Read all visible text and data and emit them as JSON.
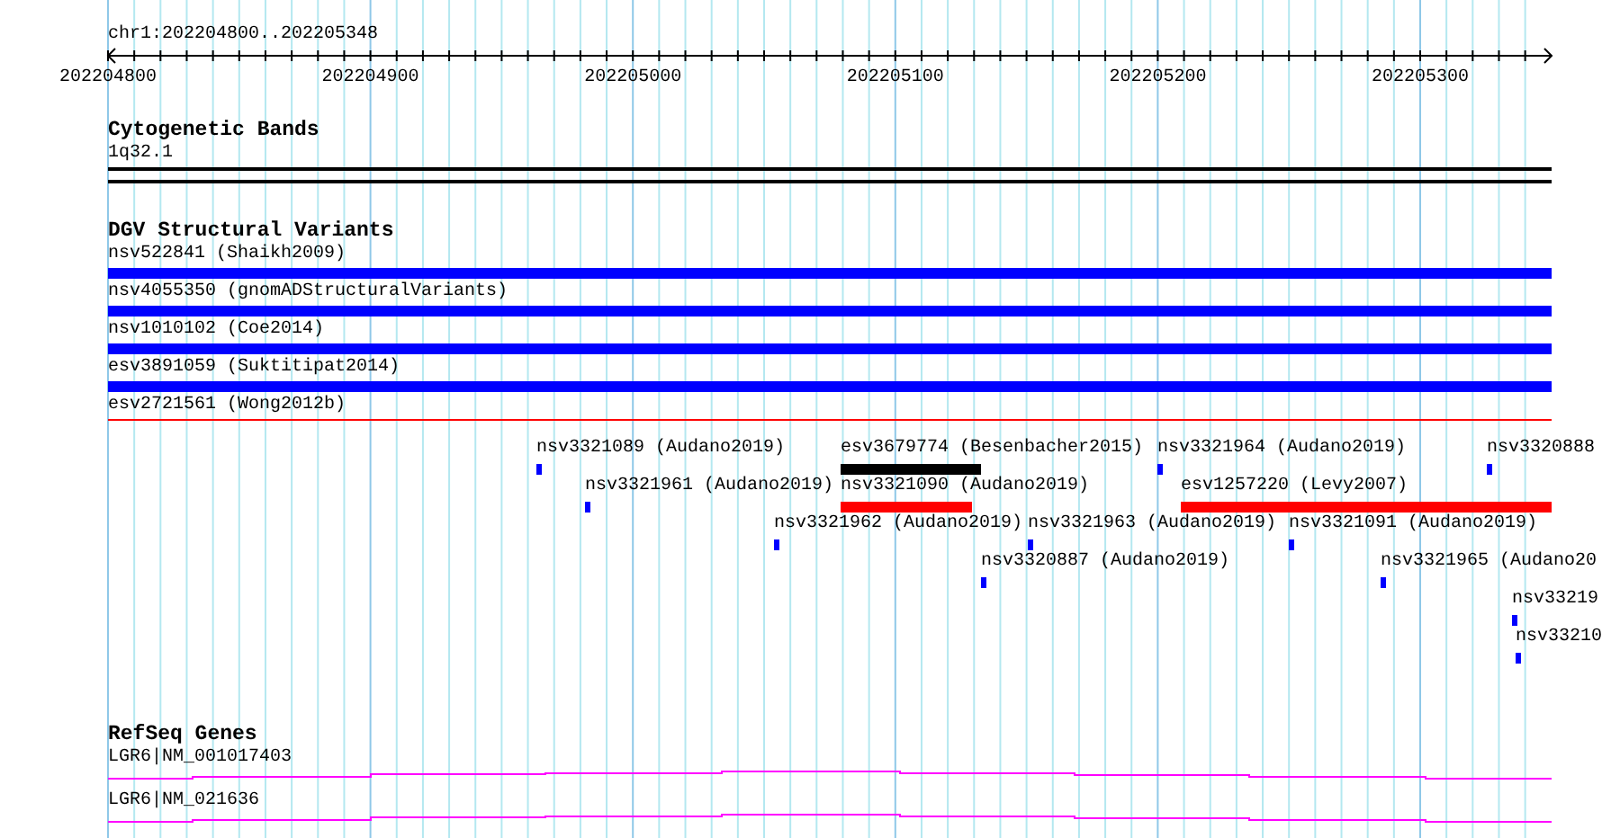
{
  "location": "chr1:202204800..202205348",
  "ruler": {
    "labels": [
      "202204800",
      "202204900",
      "202205000",
      "202205100",
      "202205200",
      "202205300"
    ]
  },
  "tracks": [
    {
      "kind": "cytoband",
      "title": "Cytogenetic Bands",
      "features": [
        {
          "label": "1q32.1"
        }
      ]
    },
    {
      "kind": "variants",
      "title": "DGV Structural Variants",
      "stacked": [
        {
          "label": "nsv522841 (Shaikh2009)",
          "color": "#0000ff",
          "kind": "bar"
        },
        {
          "label": "nsv4055350 (gnomADStructuralVariants)",
          "color": "#0000ff",
          "kind": "bar"
        },
        {
          "label": "nsv1010102 (Coe2014)",
          "color": "#0000ff",
          "kind": "bar"
        },
        {
          "label": "esv3891059 (Suktitipat2014)",
          "color": "#0000ff",
          "kind": "bar"
        },
        {
          "label": "esv2721561 (Wong2012b)",
          "color": "#ff0000",
          "kind": "line"
        }
      ],
      "scattered": [
        {
          "label": "nsv3321089 (Audano2019)",
          "color": "#0000ff"
        },
        {
          "label": "esv3679774 (Besenbacher2015)",
          "color": "#000000"
        },
        {
          "label": "nsv3321964 (Audano2019)",
          "color": "#0000ff"
        },
        {
          "label": "nsv3320888",
          "color": "#0000ff"
        },
        {
          "label": "nsv3321961 (Audano2019)",
          "color": "#0000ff"
        },
        {
          "label": "nsv3321090 (Audano2019)",
          "color": "#ff0000"
        },
        {
          "label": "esv1257220 (Levy2007)",
          "color": "#ff0000"
        },
        {
          "label": "nsv3321962 (Audano2019)",
          "color": "#0000ff"
        },
        {
          "label": "nsv3321963 (Audano2019)",
          "color": "#0000ff"
        },
        {
          "label": "nsv3321091 (Audano2019)",
          "color": "#0000ff"
        },
        {
          "label": "nsv3320887 (Audano2019)",
          "color": "#0000ff"
        },
        {
          "label": "nsv3321965 (Audano20",
          "color": "#0000ff"
        },
        {
          "label": "nsv33219",
          "color": "#0000ff"
        },
        {
          "label": "nsv33210",
          "color": "#0000ff"
        }
      ]
    },
    {
      "kind": "genes",
      "title": "RefSeq Genes",
      "features": [
        {
          "label": "LGR6|NM_001017403"
        },
        {
          "label": "LGR6|NM_021636"
        }
      ]
    }
  ]
}
